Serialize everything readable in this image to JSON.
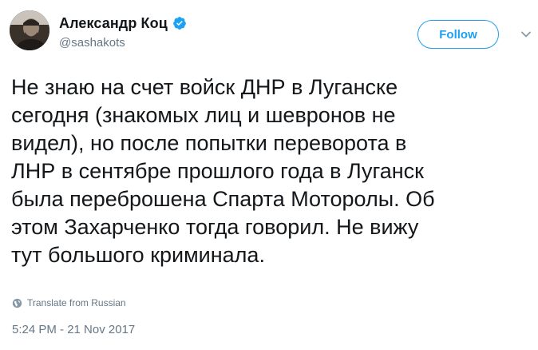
{
  "user": {
    "display_name": "Александр Коц",
    "handle": "@sashakots",
    "verified_icon": "verified-badge-icon",
    "avatar_icon": "avatar"
  },
  "actions": {
    "follow_label": "Follow",
    "menu_icon": "chevron-down-icon"
  },
  "tweet": {
    "text": "Не знаю на счет войск ДНР в Луганске\nсегодня (знакомых лиц и шевронов не\nвидел), но после попытки переворота в\nЛНР в сентябре прошлого года в Луганск\nбыла переброшена Спарта Моторолы. Об\nэтом Захарченко тогда говорил. Не вижу\nтут большого криминала.",
    "translate_label": "Translate from Russian",
    "translate_icon": "globe-icon",
    "timestamp": "5:24 PM - 21 Nov 2017"
  },
  "colors": {
    "accent": "#1da1f2",
    "text": "#14171a",
    "secondary": "#657786"
  }
}
